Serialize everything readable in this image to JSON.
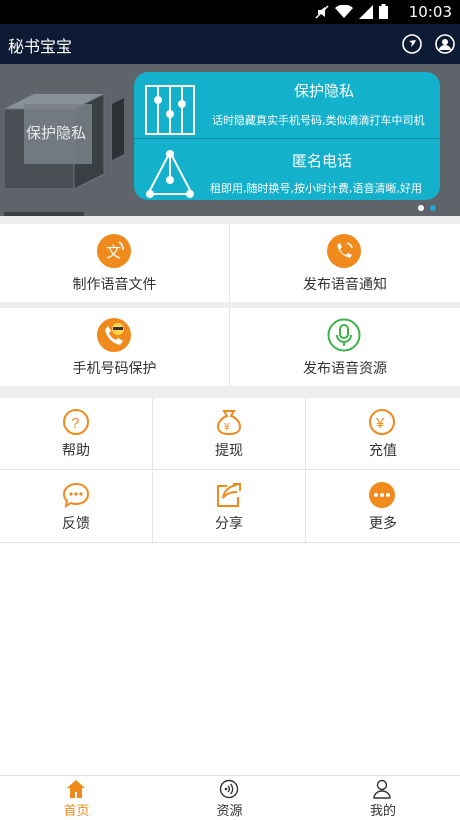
{
  "status_bar": {
    "time": "10:03",
    "icons": [
      "mute-icon",
      "wifi-icon",
      "signal-icon",
      "battery-icon"
    ]
  },
  "app_bar": {
    "title": "秘书宝宝",
    "actions": [
      "dial-icon",
      "user-icon"
    ]
  },
  "banner": {
    "cube_label": "保护隐私",
    "card": {
      "title1": "保护隐私",
      "sub1": "话时隐藏真实手机号码,类似滴滴打车中司机",
      "title2": "匿名电话",
      "sub2": "租即用,随时换号,按小时计费,语音清晰,好用"
    },
    "pager": {
      "count": 2,
      "active": 1
    }
  },
  "primary_row1": [
    {
      "label": "制作语音文件",
      "icon": "voice-file-icon"
    },
    {
      "label": "发布语音通知",
      "icon": "voice-notice-icon"
    }
  ],
  "primary_row2": [
    {
      "label": "手机号码保护",
      "icon": "phone-protect-icon"
    },
    {
      "label": "发布语音资源",
      "icon": "mic-icon"
    }
  ],
  "grid_row1": [
    {
      "label": "帮助",
      "icon": "help-icon"
    },
    {
      "label": "提现",
      "icon": "withdraw-icon"
    },
    {
      "label": "充值",
      "icon": "recharge-icon"
    }
  ],
  "grid_row2": [
    {
      "label": "反馈",
      "icon": "feedback-icon"
    },
    {
      "label": "分享",
      "icon": "share-icon"
    },
    {
      "label": "更多",
      "icon": "more-icon"
    }
  ],
  "tab_bar": [
    {
      "label": "首页",
      "icon": "home-icon",
      "active": true
    },
    {
      "label": "资源",
      "icon": "resource-icon",
      "active": false
    },
    {
      "label": "我的",
      "icon": "profile-icon",
      "active": false
    }
  ],
  "colors": {
    "accent": "#f08a1c",
    "green": "#3db34a",
    "banner_card": "#14b1cc",
    "app_bar": "#0d1a33",
    "tab_inactive": "#333333"
  }
}
